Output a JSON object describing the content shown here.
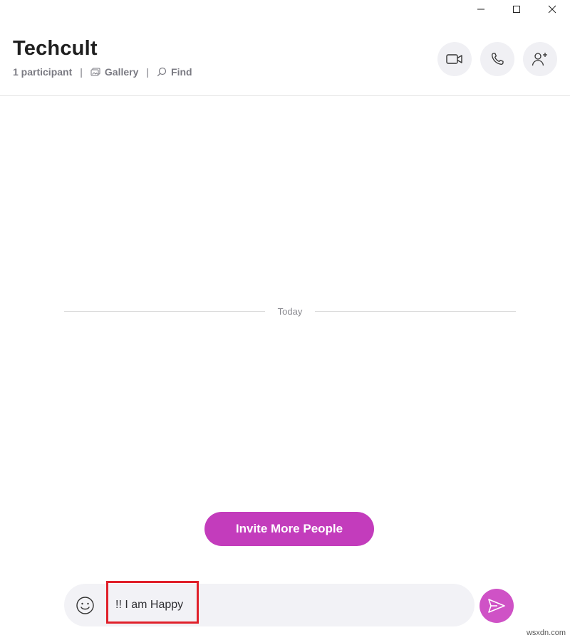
{
  "conversation": {
    "title": "Techcult",
    "participants": "1 participant",
    "gallery_label": "Gallery",
    "find_label": "Find"
  },
  "window_controls": {
    "icons": [
      "minimize-icon",
      "maximize-icon",
      "close-icon"
    ]
  },
  "header_actions": {
    "icons": [
      "video-call-icon",
      "audio-call-icon",
      "add-people-icon"
    ]
  },
  "timeline": {
    "divider_label": "Today"
  },
  "invite": {
    "label": "Invite More People"
  },
  "composer": {
    "value": "!! I am Happy",
    "emoji_icon": "smiley-icon",
    "send_icon": "send-icon"
  },
  "colors": {
    "accent": "#c33cbc",
    "send": "#cf52c6",
    "highlight": "#e0202a"
  },
  "watermark": "wsxdn.com"
}
